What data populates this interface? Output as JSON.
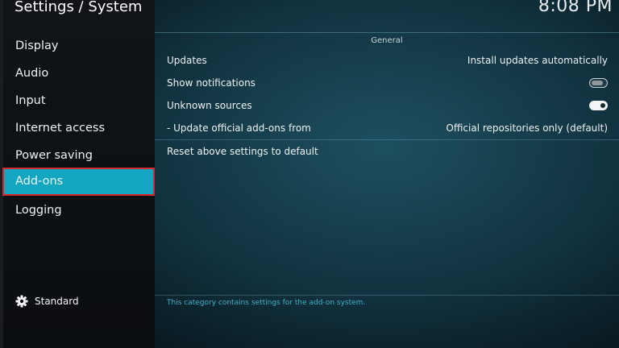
{
  "header": {
    "title": "Settings / System",
    "clock": "8:08 PM"
  },
  "sidebar": {
    "items": [
      {
        "label": "Display",
        "active": false
      },
      {
        "label": "Audio",
        "active": false
      },
      {
        "label": "Input",
        "active": false
      },
      {
        "label": "Internet access",
        "active": false
      },
      {
        "label": "Power saving",
        "active": false
      },
      {
        "label": "Add-ons",
        "active": true
      },
      {
        "label": "Logging",
        "active": false
      }
    ],
    "settings_level": {
      "icon": "gear-icon",
      "label": "Standard"
    }
  },
  "main": {
    "section_heading": "General",
    "settings": [
      {
        "label": "Updates",
        "value": "Install updates automatically"
      },
      {
        "label": "Show notifications",
        "toggle": false
      },
      {
        "label": "Unknown sources",
        "toggle": true
      },
      {
        "label": "- Update official add-ons from",
        "value": "Official repositories only (default)"
      }
    ],
    "reset_label": "Reset above settings to default",
    "description": "This category contains settings for the add-on system."
  },
  "colors": {
    "accent": "#12a6c0",
    "highlight_border": "#d8262e",
    "description_text": "#3fb0c8"
  }
}
